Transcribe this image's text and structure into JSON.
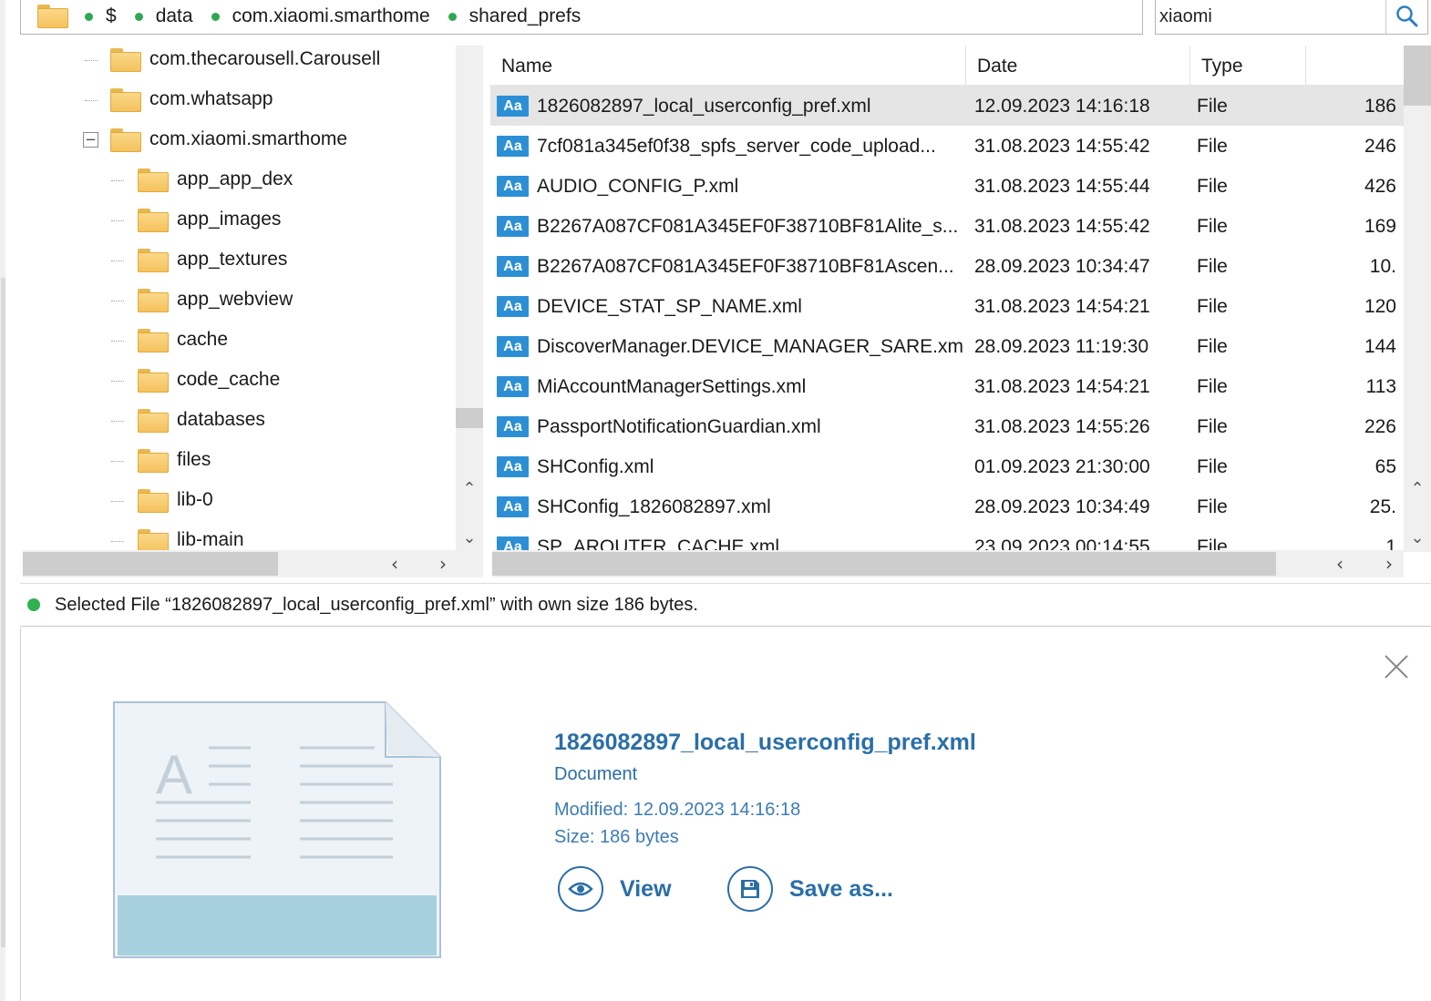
{
  "breadcrumb": {
    "items": [
      "$",
      "data",
      "com.xiaomi.smarthome",
      "shared_prefs"
    ]
  },
  "search": {
    "value": "xiaomi"
  },
  "tree": {
    "items": [
      {
        "label": "com.thecarousell.Carousell"
      },
      {
        "label": "com.whatsapp"
      },
      {
        "label": "com.xiaomi.smarthome",
        "expander": "−"
      },
      {
        "label": "app_app_dex"
      },
      {
        "label": "app_images"
      },
      {
        "label": "app_textures"
      },
      {
        "label": "app_webview"
      },
      {
        "label": "cache"
      },
      {
        "label": "code_cache"
      },
      {
        "label": "databases"
      },
      {
        "label": "files"
      },
      {
        "label": "lib-0"
      },
      {
        "label": "lib-main"
      }
    ]
  },
  "filelist": {
    "columns": {
      "name": "Name",
      "date": "Date",
      "type": "Type"
    },
    "file_icon_text": "Aa",
    "rows": [
      {
        "name": "1826082897_local_userconfig_pref.xml",
        "date": "12.09.2023 14:16:18",
        "type": "File",
        "size": "186"
      },
      {
        "name": "7cf081a345ef0f38_spfs_server_code_upload...",
        "date": "31.08.2023 14:55:42",
        "type": "File",
        "size": "246"
      },
      {
        "name": "AUDIO_CONFIG_P.xml",
        "date": "31.08.2023 14:55:44",
        "type": "File",
        "size": "426"
      },
      {
        "name": "B2267A087CF081A345EF0F38710BF81Alite_s...",
        "date": "31.08.2023 14:55:42",
        "type": "File",
        "size": "169"
      },
      {
        "name": "B2267A087CF081A345EF0F38710BF81Ascen...",
        "date": "28.09.2023 10:34:47",
        "type": "File",
        "size": "10."
      },
      {
        "name": "DEVICE_STAT_SP_NAME.xml",
        "date": "31.08.2023 14:54:21",
        "type": "File",
        "size": "120"
      },
      {
        "name": "DiscoverManager.DEVICE_MANAGER_SARE.xml",
        "date": "28.09.2023 11:19:30",
        "type": "File",
        "size": "144"
      },
      {
        "name": "MiAccountManagerSettings.xml",
        "date": "31.08.2023 14:54:21",
        "type": "File",
        "size": "113"
      },
      {
        "name": "PassportNotificationGuardian.xml",
        "date": "31.08.2023 14:55:26",
        "type": "File",
        "size": "226"
      },
      {
        "name": "SHConfig.xml",
        "date": "01.09.2023 21:30:00",
        "type": "File",
        "size": "65"
      },
      {
        "name": "SHConfig_1826082897.xml",
        "date": "28.09.2023 10:34:49",
        "type": "File",
        "size": "25."
      },
      {
        "name": "SP_AROUTER_CACHE.xml",
        "date": "23.09.2023 00:14:55",
        "type": "File",
        "size": "1"
      }
    ]
  },
  "status": {
    "text": "Selected File “1826082897_local_userconfig_pref.xml” with own size 186 bytes."
  },
  "preview": {
    "filename": "1826082897_local_userconfig_pref.xml",
    "kind": "Document",
    "modified": "Modified: 12.09.2023 14:16:18",
    "size": "Size: 186 bytes",
    "view_label": "View",
    "save_label": "Save as..."
  },
  "colors": {
    "accent": "#2a6ea8",
    "file_icon": "#2c8fd6",
    "status_dot": "#2fb14f",
    "selection": "#e5e5e5"
  }
}
